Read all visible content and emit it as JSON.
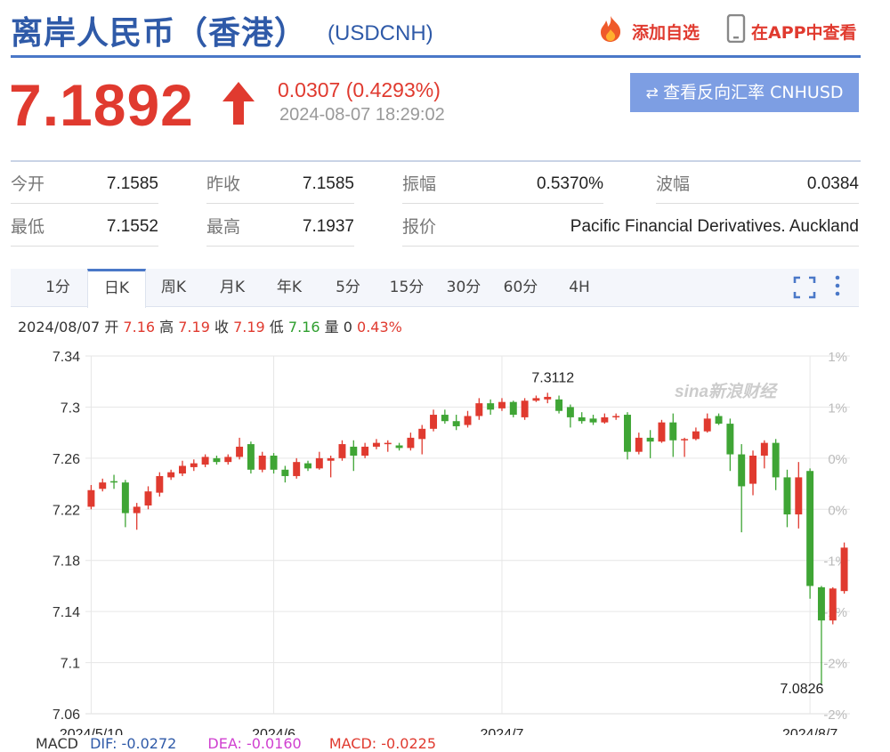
{
  "header": {
    "title": "离岸人民币（香港）",
    "symbol": "(USDCNH)",
    "add_watch": "添加自选",
    "open_app": "在APP中查看"
  },
  "quote": {
    "price": "7.1892",
    "change": "0.0307 (0.4293%)",
    "timestamp": "2024-08-07 18:29:02",
    "reverse_rate_button": "查看反向汇率 CNHUSD"
  },
  "stats": {
    "row1": [
      {
        "label": "今开",
        "value": "7.1585"
      },
      {
        "label": "昨收",
        "value": "7.1585"
      },
      {
        "label": "振幅",
        "value": "0.5370%"
      },
      {
        "label": "波幅",
        "value": "0.0384"
      }
    ],
    "row2": [
      {
        "label": "最低",
        "value": "7.1552"
      },
      {
        "label": "最高",
        "value": "7.1937"
      },
      {
        "label": "报价",
        "value": "Pacific Financial Derivatives. Auckland"
      }
    ]
  },
  "tabs": [
    "1分",
    "日K",
    "周K",
    "月K",
    "年K",
    "5分",
    "15分",
    "30分",
    "60分",
    "4H"
  ],
  "active_tab": "日K",
  "bar_info": {
    "date": "2024/08/07",
    "open_label": "开",
    "open": "7.16",
    "high_label": "高",
    "high": "7.19",
    "close_label": "收",
    "close": "7.19",
    "low_label": "低",
    "low": "7.16",
    "vol_label": "量",
    "vol": "0",
    "pct": "0.43%"
  },
  "colors": {
    "up": "#e03a2f",
    "down": "#3fa535",
    "accent": "#4a78c8"
  },
  "chart_data": {
    "type": "candlestick",
    "y_ticks": [
      "7.34",
      "7.3",
      "7.26",
      "7.22",
      "7.18",
      "7.14",
      "7.1",
      "7.06"
    ],
    "y_tick_values": [
      7.34,
      7.3,
      7.26,
      7.22,
      7.18,
      7.14,
      7.1,
      7.06
    ],
    "right_ticks": [
      "1%",
      "1%",
      "0%",
      "0%",
      "-1%",
      "-1%",
      "-2%",
      "-2%"
    ],
    "ylim": [
      7.06,
      7.34
    ],
    "x_ticks": [
      {
        "label": "2024/5/10",
        "index": 0
      },
      {
        "label": "2024/6",
        "index": 16
      },
      {
        "label": "2024/7",
        "index": 36
      },
      {
        "label": "2024/8/7",
        "index": 63
      }
    ],
    "max_label": "7.3112",
    "min_label": "7.0826",
    "candles": [
      [
        7.222,
        7.235,
        7.239,
        7.22
      ],
      [
        7.236,
        7.241,
        7.244,
        7.234
      ],
      [
        7.242,
        7.241,
        7.247,
        7.236
      ],
      [
        7.241,
        7.217,
        7.243,
        7.206
      ],
      [
        7.217,
        7.222,
        7.225,
        7.204
      ],
      [
        7.223,
        7.234,
        7.238,
        7.22
      ],
      [
        7.233,
        7.246,
        7.249,
        7.23
      ],
      [
        7.245,
        7.249,
        7.251,
        7.243
      ],
      [
        7.248,
        7.254,
        7.258,
        7.246
      ],
      [
        7.253,
        7.256,
        7.259,
        7.25
      ],
      [
        7.255,
        7.261,
        7.263,
        7.253
      ],
      [
        7.26,
        7.257,
        7.262,
        7.255
      ],
      [
        7.257,
        7.261,
        7.263,
        7.255
      ],
      [
        7.261,
        7.269,
        7.276,
        7.259
      ],
      [
        7.271,
        7.251,
        7.273,
        7.248
      ],
      [
        7.251,
        7.262,
        7.265,
        7.249
      ],
      [
        7.262,
        7.251,
        7.264,
        7.248
      ],
      [
        7.251,
        7.246,
        7.254,
        7.241
      ],
      [
        7.246,
        7.257,
        7.26,
        7.244
      ],
      [
        7.256,
        7.252,
        7.258,
        7.25
      ],
      [
        7.252,
        7.26,
        7.265,
        7.251
      ],
      [
        7.258,
        7.26,
        7.262,
        7.245
      ],
      [
        7.26,
        7.271,
        7.274,
        7.258
      ],
      [
        7.269,
        7.262,
        7.274,
        7.25
      ],
      [
        7.262,
        7.269,
        7.272,
        7.26
      ],
      [
        7.269,
        7.272,
        7.275,
        7.267
      ],
      [
        7.271,
        7.272,
        7.274,
        7.265
      ],
      [
        7.27,
        7.268,
        7.272,
        7.266
      ],
      [
        7.268,
        7.276,
        7.28,
        7.266
      ],
      [
        7.275,
        7.283,
        7.286,
        7.263
      ],
      [
        7.283,
        7.294,
        7.298,
        7.281
      ],
      [
        7.294,
        7.289,
        7.298,
        7.287
      ],
      [
        7.289,
        7.285,
        7.294,
        7.282
      ],
      [
        7.286,
        7.293,
        7.297,
        7.284
      ],
      [
        7.293,
        7.303,
        7.307,
        7.29
      ],
      [
        7.303,
        7.298,
        7.306,
        7.294
      ],
      [
        7.299,
        7.304,
        7.307,
        7.297
      ],
      [
        7.304,
        7.294,
        7.305,
        7.292
      ],
      [
        7.292,
        7.305,
        7.307,
        7.29
      ],
      [
        7.305,
        7.307,
        7.309,
        7.304
      ],
      [
        7.306,
        7.308,
        7.3112,
        7.303
      ],
      [
        7.306,
        7.297,
        7.309,
        7.295
      ],
      [
        7.3,
        7.292,
        7.302,
        7.284
      ],
      [
        7.292,
        7.289,
        7.296,
        7.287
      ],
      [
        7.291,
        7.288,
        7.294,
        7.286
      ],
      [
        7.288,
        7.292,
        7.295,
        7.287
      ],
      [
        7.292,
        7.293,
        7.295,
        7.29
      ],
      [
        7.294,
        7.265,
        7.296,
        7.259
      ],
      [
        7.265,
        7.276,
        7.28,
        7.263
      ],
      [
        7.276,
        7.273,
        7.282,
        7.26
      ],
      [
        7.273,
        7.288,
        7.29,
        7.272
      ],
      [
        7.288,
        7.274,
        7.295,
        7.261
      ],
      [
        7.274,
        7.275,
        7.276,
        7.261
      ],
      [
        7.275,
        7.281,
        7.284,
        7.274
      ],
      [
        7.281,
        7.291,
        7.295,
        7.28
      ],
      [
        7.293,
        7.287,
        7.295,
        7.286
      ],
      [
        7.287,
        7.263,
        7.291,
        7.25
      ],
      [
        7.263,
        7.238,
        7.271,
        7.202
      ],
      [
        7.24,
        7.262,
        7.266,
        7.231
      ],
      [
        7.262,
        7.272,
        7.274,
        7.252
      ],
      [
        7.272,
        7.245,
        7.275,
        7.235
      ],
      [
        7.245,
        7.216,
        7.251,
        7.206
      ],
      [
        7.216,
        7.245,
        7.257,
        7.205
      ],
      [
        7.25,
        7.16,
        7.252,
        7.15
      ],
      [
        7.159,
        7.133,
        7.16,
        7.083
      ],
      [
        7.133,
        7.158,
        7.159,
        7.13
      ],
      [
        7.156,
        7.19,
        7.194,
        7.154
      ]
    ]
  },
  "macd": {
    "title": "MACD",
    "dif": "DIF: -0.0272",
    "dea": "DEA: -0.0160",
    "macd": "MACD: -0.0225"
  },
  "watermark": "sina新浪财经"
}
